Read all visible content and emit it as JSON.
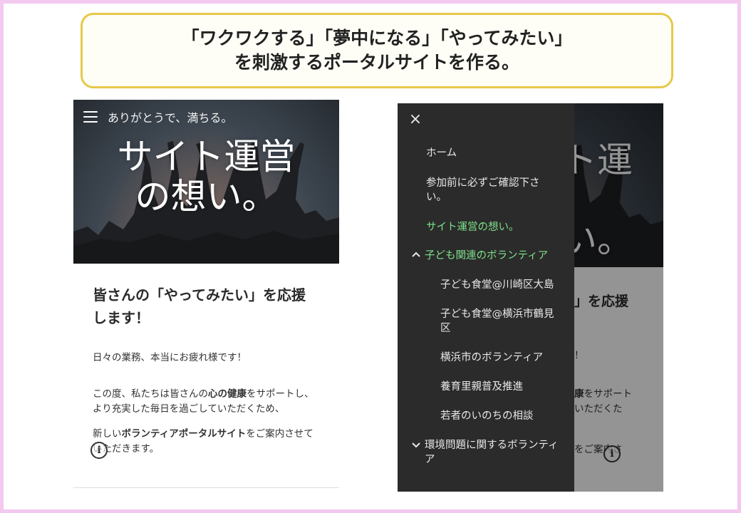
{
  "headline": {
    "line1": "「ワクワクする」「夢中になる」「やってみたい」",
    "line2": "を刺激するポータルサイトを作る。"
  },
  "site": {
    "tagline": "ありがとうで、満ちる。",
    "hero_line1": "サイト運営",
    "hero_line2": "の想い。"
  },
  "article": {
    "heading_line1": "皆さんの「やってみたい」を応援",
    "heading_line2": "します！",
    "p1": "日々の業務、本当にお疲れ様です！",
    "p2_a": "この度、私たちは皆さんの",
    "p2_bold": "心の健康",
    "p2_b": "をサポートし、より充実した毎日を過ごしていただくため、",
    "p3_a": "新しい",
    "p3_bold": "ボランティアポータルサイト",
    "p3_b": "をご案内させていただきます。"
  },
  "right_visible": {
    "heading_fragment": "」を応援",
    "p1_fragment": "！",
    "p2_frag1a": "",
    "p2_frag1b": "康",
    "p2_frag1c": "をサポート",
    "p2_frag2": "いただくた",
    "p3_frag": "をご案内さ"
  },
  "drawer": {
    "close_label": "×",
    "items": [
      {
        "label": "ホーム"
      },
      {
        "label": "参加前に必ずご確認下さい。"
      },
      {
        "label": "サイト運営の想い。"
      },
      {
        "label": "子ども関連のボランティア"
      },
      {
        "label": "子ども食堂@川崎区大島"
      },
      {
        "label": "子ども食堂@横浜市鶴見区"
      },
      {
        "label": "横浜市のボランティア"
      },
      {
        "label": "養育里親普及推進"
      },
      {
        "label": "若者のいのちの相談"
      },
      {
        "label": "環境問題に関するボランティア"
      }
    ],
    "chevron_up": "^",
    "chevron_down": "v"
  },
  "icons": {
    "info": "i",
    "menu": "hamburger-icon",
    "close": "close-icon"
  },
  "colors": {
    "frame_pink": "#f3c9ef",
    "headline_border": "#e7c84a",
    "drawer_bg": "#2b2b2b",
    "active_green": "#7ee08a"
  }
}
